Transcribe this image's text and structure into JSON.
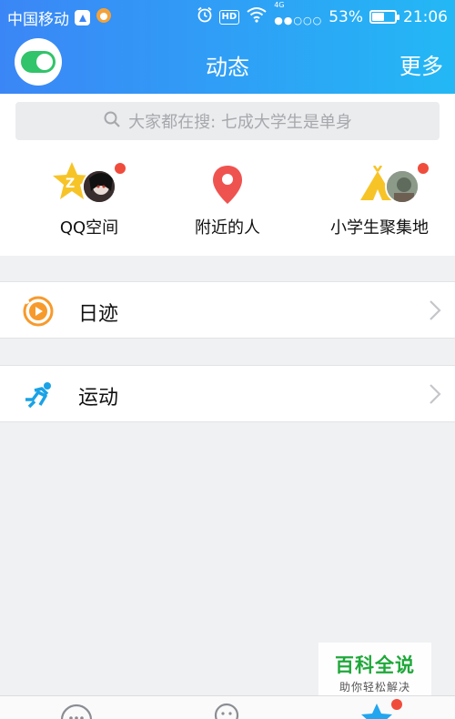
{
  "status_bar": {
    "carrier": "中国移动",
    "network_type": "4G",
    "hd_label": "HD",
    "battery_percent": "53%",
    "battery_level": 0.53,
    "time": "21:06"
  },
  "nav": {
    "title": "动态",
    "more": "更多"
  },
  "search": {
    "placeholder": "大家都在搜: 七成大学生是单身"
  },
  "quick_entries": [
    {
      "label": "QQ空间",
      "icon": "star-icon",
      "has_dot": true
    },
    {
      "label": "附近的人",
      "icon": "location-pin-icon",
      "has_dot": false
    },
    {
      "label": "小学生聚集地",
      "icon": "tent-icon",
      "has_dot": true
    }
  ],
  "list": [
    {
      "label": "日迹",
      "icon": "play-circle-icon"
    },
    {
      "label": "运动",
      "icon": "runner-icon"
    }
  ],
  "watermark": {
    "title": "百科全说",
    "subtitle": "助你轻松解决"
  },
  "colors": {
    "header_gradient_start": "#3b86f6",
    "header_gradient_end": "#23b8f5",
    "toggle_green": "#31c46a",
    "badge_red": "#f04c3c",
    "star_yellow": "#f7c428",
    "pin_red": "#ef5350",
    "riji_orange": "#f79a2c",
    "runner_blue": "#1aa2e6"
  }
}
